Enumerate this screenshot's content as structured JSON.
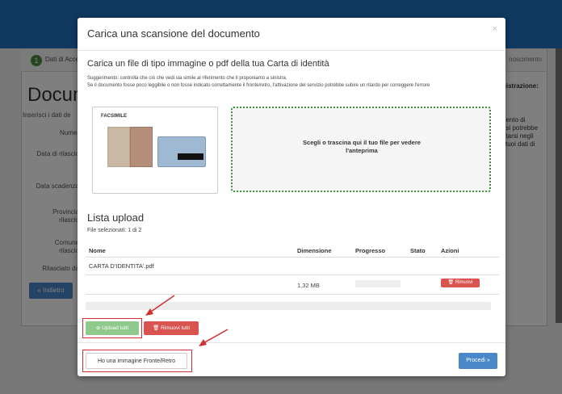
{
  "background": {
    "step_number": "1",
    "step_label": "Dati di Acce",
    "right_step_label": "noscimento",
    "page_title": "Docum",
    "subtitle": "Inserisci i dati de",
    "field_labels": [
      "Numer",
      "Data di rilascio",
      "Data scadenza",
      "Provincia",
      "rilascio",
      "Comune",
      "rilascio",
      "Rilasciato da"
    ],
    "side_heading": "gistrazione:",
    "side_text": [
      "nento di",
      "asi potrebbe",
      "ntarsi negli",
      "i tuoi dati di"
    ],
    "back_button": "« Indietro"
  },
  "modal": {
    "title": "Carica una scansione del documento",
    "close_glyph": "×",
    "heading": "Carica un file di tipo immagine o pdf della tua Carta di identità",
    "hint_line1": "Suggerimento: controlla che ciò che vedi sia simile al riferimento che ti proponiamo a sinistra.",
    "hint_line2": "Se il documento fosse poco leggibile o non fosse indicato correttamente il fronte/retro, l'attivazione del servizio potrebbe subire un ritardo per correggere l'errore",
    "facsimile_label": "FACSIMILE",
    "dropzone_text": "Scegli o trascina qui il tuo file per vedere l'anteprima",
    "upload_list_title": "Lista upload",
    "files_selected": "File selezionati: 1 di 2",
    "columns": [
      "Nome",
      "Dimensione",
      "Progresso",
      "Stato",
      "Azioni"
    ],
    "file": {
      "name": "CARTA D'IDENTITA'.pdf",
      "size": "1,32 MB",
      "progress": 0,
      "remove_label": "Rimuovi"
    },
    "upload_all_label": "Upload tutti",
    "remove_all_label": "Rimuovi tutti",
    "front_back_label": "Ho una immagine Fronte/Retro",
    "proceed_label": "Procedi »"
  },
  "colors": {
    "brand_blue": "#1e73be",
    "success_green": "#8fc98b",
    "danger_red": "#d9534f",
    "annotation_red": "#d03030",
    "dropzone_border": "#3c8d3c"
  },
  "icons": {
    "upload": "circle-upload-icon",
    "trash": "trash-icon",
    "close": "close-icon"
  }
}
